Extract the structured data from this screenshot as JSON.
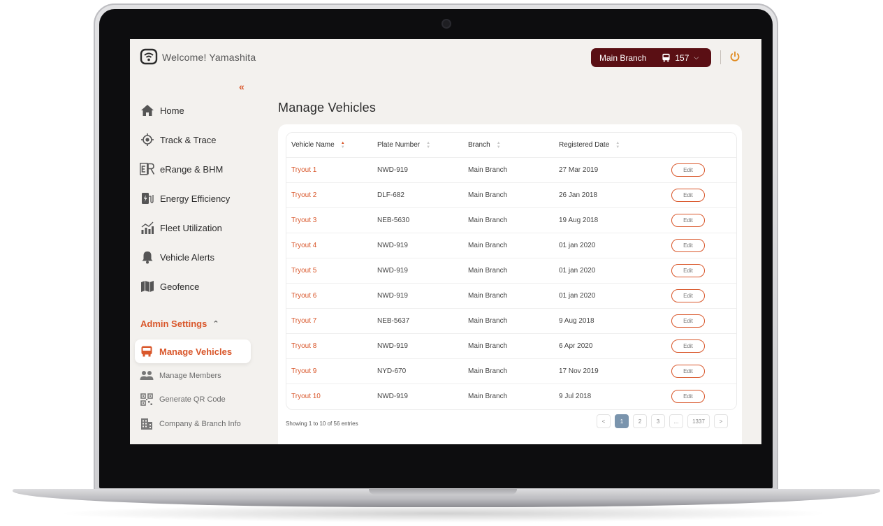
{
  "header": {
    "welcome": "Welcome! Yamashita",
    "branch": "Main Branch",
    "vehicle_count": "157"
  },
  "sidebar": {
    "items": [
      {
        "label": "Home",
        "icon": "home-icon"
      },
      {
        "label": "Track & Trace",
        "icon": "target-icon"
      },
      {
        "label": "eRange & BHM",
        "icon": "erange-icon"
      },
      {
        "label": "Energy Efficiency",
        "icon": "charging-station-icon"
      },
      {
        "label": "Fleet Utilization",
        "icon": "bar-chart-icon"
      },
      {
        "label": "Vehicle Alerts",
        "icon": "bell-icon"
      },
      {
        "label": "Geofence",
        "icon": "map-icon"
      }
    ],
    "admin_title": "Admin Settings",
    "admin_items": [
      {
        "label": "Manage Vehicles",
        "icon": "bus-icon",
        "active": true
      },
      {
        "label": "Manage Members",
        "icon": "users-icon"
      },
      {
        "label": "Generate QR Code",
        "icon": "qr-code-icon"
      },
      {
        "label": "Company & Branch Info",
        "icon": "building-icon"
      }
    ]
  },
  "main": {
    "title": "Manage Vehicles",
    "table": {
      "columns": [
        "Vehicle Name",
        "Plate Number",
        "Branch",
        "Registered Date"
      ],
      "rows": [
        {
          "name": "Tryout 1",
          "plate": "NWD-919",
          "branch": "Main Branch",
          "date": "27 Mar 2019",
          "action": "Edit"
        },
        {
          "name": "Tryout 2",
          "plate": "DLF-682",
          "branch": "Main Branch",
          "date": "26 Jan 2018",
          "action": "Edit"
        },
        {
          "name": "Tryout 3",
          "plate": "NEB-5630",
          "branch": "Main Branch",
          "date": "19 Aug 2018",
          "action": "Edit"
        },
        {
          "name": "Tryout 4",
          "plate": "NWD-919",
          "branch": "Main Branch",
          "date": "01 jan 2020",
          "action": "Edit"
        },
        {
          "name": "Tryout 5",
          "plate": "NWD-919",
          "branch": "Main Branch",
          "date": "01 jan 2020",
          "action": "Edit"
        },
        {
          "name": "Tryout 6",
          "plate": "NWD-919",
          "branch": "Main Branch",
          "date": "01 jan 2020",
          "action": "Edit"
        },
        {
          "name": "Tryout 7",
          "plate": "NEB-5637",
          "branch": "Main Branch",
          "date": "9 Aug 2018",
          "action": "Edit"
        },
        {
          "name": "Tryout 8",
          "plate": "NWD-919",
          "branch": "Main Branch",
          "date": "6 Apr 2020",
          "action": "Edit"
        },
        {
          "name": "Tryout 9",
          "plate": "NYD-670",
          "branch": "Main Branch",
          "date": "17 Nov 2019",
          "action": "Edit"
        },
        {
          "name": "Tryout 10",
          "plate": "NWD-919",
          "branch": "Main Branch",
          "date": "9 Jul 2018",
          "action": "Edit"
        }
      ]
    },
    "showing": "Showing 1 to 10 of 56 entries",
    "pagination": {
      "prev": "<",
      "pages": [
        "1",
        "2",
        "3",
        "...",
        "1337"
      ],
      "next": ">"
    }
  },
  "colors": {
    "accent": "#d9572b",
    "branch_pill": "#5a0f14",
    "active_page": "#7a94ad",
    "screen_bg": "#f3f1ee"
  }
}
